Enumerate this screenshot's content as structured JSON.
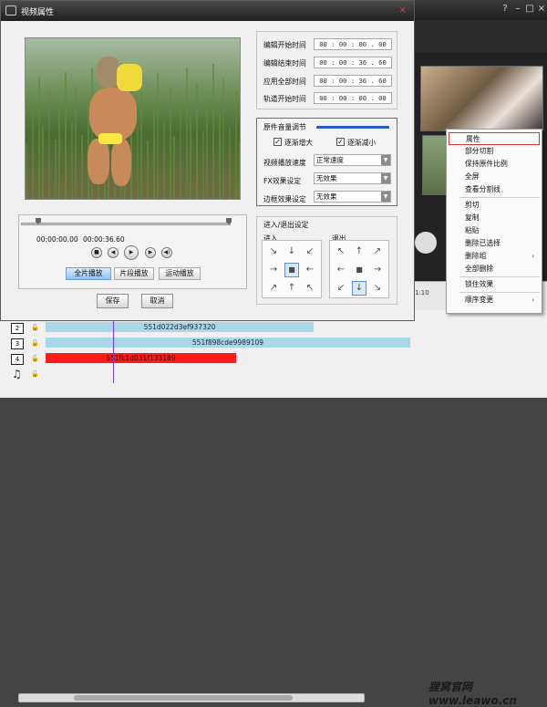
{
  "app": {
    "window_buttons": {
      "help": "?",
      "minimize": "–",
      "maximize": "□",
      "close": "×"
    }
  },
  "dialog": {
    "title": "视频属性",
    "close_glyph": "×",
    "playback": {
      "start_time": "00:00:00.00",
      "end_time": "00:00:36.60",
      "controls": [
        "■",
        "◀",
        "▶",
        "▶",
        "◀)"
      ],
      "slider_position_fraction": 0.0,
      "modes": [
        "全片播放",
        "片段播放",
        "运动播放"
      ],
      "active_mode_index": 0
    },
    "buttons": {
      "save": "保存",
      "cancel": "取消"
    },
    "times": [
      {
        "label": "编辑开始时间",
        "value": "00 :  00 :  00 .  00"
      },
      {
        "label": "编辑结束时间",
        "value": "00 :  00 :  36 .  60"
      },
      {
        "label": "应用全部时间",
        "value": "00 :  00 :  36 .  60"
      },
      {
        "label": "轨道开始时间",
        "value": "00 :  00 :  00 .  00"
      }
    ],
    "audio": {
      "title": "原件音量调节",
      "fade_in": {
        "label": "逐渐增大",
        "checked": true
      },
      "fade_out": {
        "label": "逐渐减小",
        "checked": true
      },
      "settings": [
        {
          "label": "视频播放速度",
          "value": "正常速度"
        },
        {
          "label": "FX效果设定",
          "value": "无效果"
        },
        {
          "label": "边框效果设定",
          "value": "无效果"
        }
      ],
      "accent_color": "#d44444"
    },
    "transitions": {
      "title": "进入/退出设定",
      "in_label": "进入",
      "out_label": "退出",
      "in_grid": [
        "↘",
        "↓",
        "↙",
        "→",
        "■",
        "←",
        "↗",
        "↑",
        "↖"
      ],
      "in_selected": 4,
      "out_grid": [
        "↖",
        "↑",
        "↗",
        "←",
        "■",
        "→",
        "↙",
        "↓",
        "↘"
      ],
      "out_selected": 7
    }
  },
  "context_menu": {
    "items": [
      {
        "label": "属性",
        "highlighted": true
      },
      {
        "label": "部分切割"
      },
      {
        "label": "保持原件比例"
      },
      {
        "label": "全屏"
      },
      {
        "label": "查看分割线"
      },
      {
        "sep": true
      },
      {
        "label": "剪切"
      },
      {
        "label": "复制"
      },
      {
        "label": "粘贴"
      },
      {
        "label": "删除已选择"
      },
      {
        "label": "删除组",
        "submenu": true
      },
      {
        "label": "全部删除"
      },
      {
        "sep": true
      },
      {
        "label": "锁住效果"
      },
      {
        "sep": true
      },
      {
        "label": "顺序变更",
        "submenu": true
      }
    ]
  },
  "timeline": {
    "ruler_label": "1:10",
    "tracks": [
      {
        "icon": "2",
        "clip": "551d022d3ef937320",
        "color": "#a8d8e8"
      },
      {
        "icon": "3",
        "clip": "551f898cde9989109",
        "color": "#a8d8e8"
      },
      {
        "icon": "4",
        "clip": "551fc1d031f133189",
        "color": "#ff1a1a"
      },
      {
        "icon": "♫",
        "clip": "",
        "color": ""
      }
    ]
  },
  "watermark": "狸窝官网 www.leawo.cn"
}
